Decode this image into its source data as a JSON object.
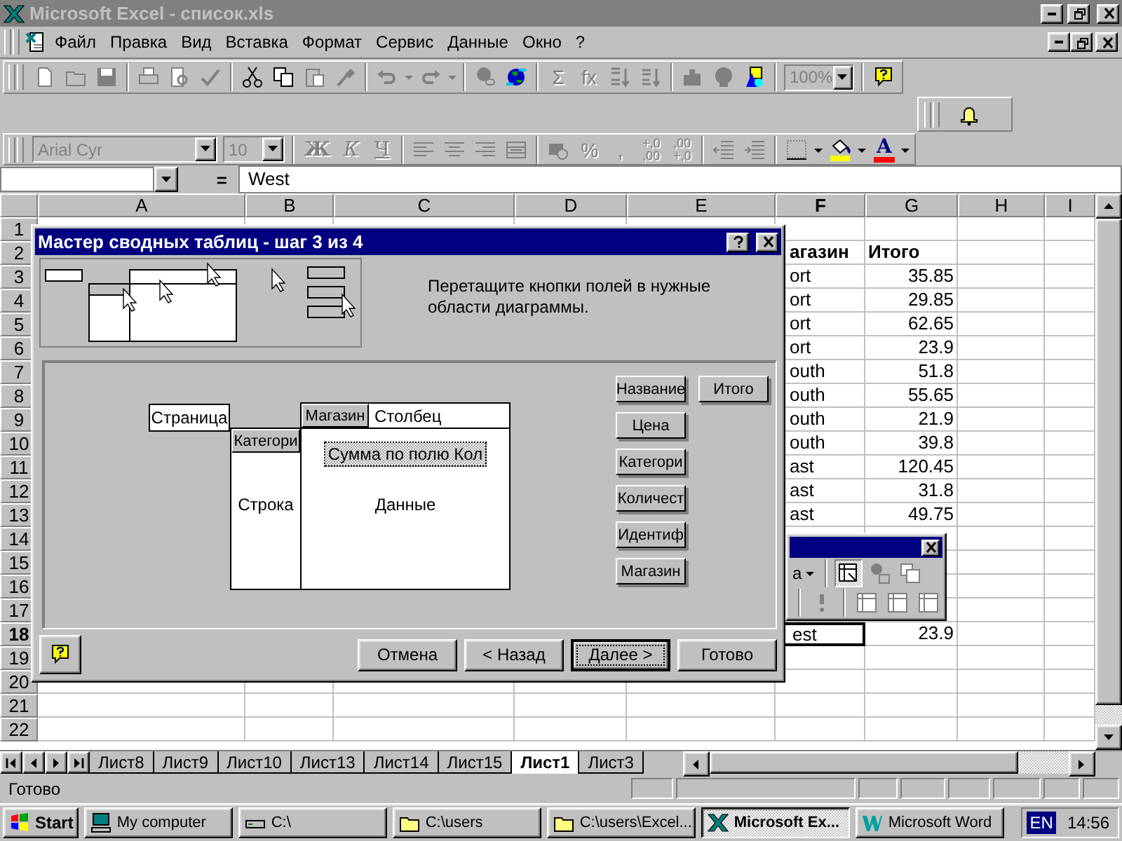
{
  "window": {
    "title": "Microsoft Excel - список.xls",
    "active": false
  },
  "menu": [
    "Файл",
    "Правка",
    "Вид",
    "Вставка",
    "Формат",
    "Сервис",
    "Данные",
    "Окно",
    "?"
  ],
  "standard_toolbar": [
    {
      "disabled": true
    },
    {
      "disabled": true
    },
    {
      "disabled": true
    },
    {
      "disabled": true
    },
    {
      "disabled": true
    },
    {
      "disabled": true
    },
    {
      "disabled": false
    },
    {
      "disabled": false
    },
    {
      "disabled": true
    },
    {
      "disabled": true
    },
    {
      "disabled": true
    },
    {
      "disabled": true
    },
    {
      "disabled": true
    },
    {
      "disabled": true
    },
    {
      "disabled": true
    },
    {
      "disabled": false
    },
    {
      "label": "Σ",
      "disabled": true
    },
    {
      "label": "fx",
      "disabled": true
    },
    {
      "disabled": true
    },
    {
      "disabled": true
    },
    {
      "disabled": true
    },
    {
      "disabled": true
    },
    {
      "disabled": false
    },
    {
      "value": "100%",
      "disabled": true
    },
    {
      "disabled": false
    }
  ],
  "formatting_toolbar": [
    {
      "value": "Arial Cyr",
      "disabled": true
    },
    {
      "value": "10",
      "disabled": true
    },
    {
      "label": "Ж",
      "disabled": true
    },
    {
      "label": "К",
      "disabled": true
    },
    {
      "label": "Ч",
      "disabled": true
    },
    {
      "disabled": true
    },
    {
      "disabled": true
    },
    {
      "disabled": true
    },
    {
      "disabled": true
    },
    {
      "disabled": true
    },
    {
      "label": "%",
      "disabled": true
    },
    {
      "label": ",",
      "disabled": true
    },
    {
      "lines": [
        "+,0",
        ",00"
      ],
      "disabled": true
    },
    {
      "lines": [
        ",00",
        "+,0"
      ],
      "disabled": true
    },
    {
      "disabled": true
    },
    {
      "disabled": true
    },
    {
      "disabled": true
    },
    {
      "disabled": false
    },
    {
      "color": "#ffff00",
      "disabled": false
    },
    {
      "disabled": false
    },
    {
      "label": "A",
      "color": "#ff0000",
      "disabled": false
    },
    {
      "disabled": false
    }
  ],
  "formula_bar": {
    "equals": "=",
    "value": "West"
  },
  "sheet": {
    "columns": [
      {
        "label": "A",
        "selected": false
      },
      {
        "label": "B",
        "selected": false
      },
      {
        "label": "C",
        "selected": false
      },
      {
        "label": "D",
        "selected": false
      },
      {
        "label": "E",
        "selected": false
      },
      {
        "label": "F",
        "selected": true
      },
      {
        "label": "G",
        "selected": false
      },
      {
        "label": "H",
        "selected": false
      },
      {
        "label": "I",
        "selected": false
      }
    ],
    "rows": [
      {
        "header": "1",
        "selected": false
      },
      {
        "header": "2",
        "selected": false,
        "kind": "heading",
        "f": "агазин",
        "g": "Итого"
      },
      {
        "header": "3",
        "selected": false,
        "f": "ort",
        "g": "35.85"
      },
      {
        "header": "4",
        "selected": false,
        "f": "ort",
        "g": "29.85"
      },
      {
        "header": "5",
        "selected": false,
        "f": "ort",
        "g": "62.65"
      },
      {
        "header": "6",
        "selected": false,
        "f": "ort",
        "g": "23.9"
      },
      {
        "header": "7",
        "selected": false,
        "f": "outh",
        "g": "51.8"
      },
      {
        "header": "8",
        "selected": false,
        "f": "outh",
        "g": "55.65"
      },
      {
        "header": "9",
        "selected": false,
        "f": "outh",
        "g": "21.9"
      },
      {
        "header": "10",
        "selected": false,
        "f": "outh",
        "g": "39.8"
      },
      {
        "header": "11",
        "selected": false,
        "f": "ast",
        "g": "120.45"
      },
      {
        "header": "12",
        "selected": false,
        "f": "ast",
        "g": "31.8"
      },
      {
        "header": "13",
        "selected": false,
        "f": "ast",
        "g": "49.75"
      },
      {
        "header": "14",
        "selected": false
      },
      {
        "header": "15",
        "selected": false
      },
      {
        "header": "16",
        "selected": false
      },
      {
        "header": "17",
        "selected": false
      },
      {
        "header": "18",
        "selected": true,
        "f": "est",
        "g": "23.9"
      },
      {
        "header": "19",
        "selected": false
      },
      {
        "header": "20",
        "selected": false
      },
      {
        "header": "21",
        "selected": false
      },
      {
        "header": "22",
        "selected": false
      }
    ]
  },
  "pivot_toolbar": {
    "dropdown_label": "а",
    "buttons": [
      {
        "pressed": true
      },
      {
        "pressed": false
      },
      {
        "pressed": false
      },
      {
        "pressed": false
      },
      {
        "pressed": false
      },
      {
        "pressed": false
      },
      {
        "pressed": false
      }
    ]
  },
  "dialog": {
    "title": "Мастер сводных таблиц - шаг 3 из 4",
    "instruction": "Перетащите кнопки полей в нужные области диаграммы.",
    "page_area": {
      "label": "Страница"
    },
    "column_area": {
      "label": "Столбец",
      "fields": [
        "Магазин"
      ]
    },
    "row_area": {
      "label": "Строка",
      "fields": [
        "Категори"
      ]
    },
    "data_area": {
      "label": "Данные",
      "fields": [
        {
          "label": "Сумма по полю Кол",
          "focused": true
        }
      ]
    },
    "available_fields": [
      "Название",
      "Цена",
      "Категори",
      "Количест",
      "Идентиф",
      "Магазин",
      "Итого"
    ],
    "buttons": [
      {
        "label": "Отмена",
        "default": false
      },
      {
        "label": "< Назад",
        "default": false
      },
      {
        "label": "Далее >",
        "default": true
      },
      {
        "label": "Готово",
        "default": false
      }
    ]
  },
  "sheet_tabs": [
    {
      "label": "Лист8",
      "selected": false
    },
    {
      "label": "Лист9",
      "selected": false
    },
    {
      "label": "Лист10",
      "selected": false
    },
    {
      "label": "Лист13",
      "selected": false
    },
    {
      "label": "Лист14",
      "selected": false
    },
    {
      "label": "Лист15",
      "selected": false
    },
    {
      "label": "Лист1",
      "selected": true
    },
    {
      "label": "Лист3",
      "selected": false
    }
  ],
  "status_bar": {
    "text": "Готово"
  },
  "taskbar": {
    "start": "Start",
    "tasks": [
      {
        "label": "My computer",
        "kind": "computer",
        "selected": false
      },
      {
        "label": "C:\\",
        "kind": "drive",
        "selected": false
      },
      {
        "label": "C:\\users",
        "kind": "folder",
        "selected": false
      },
      {
        "label": "C:\\users\\Excel...",
        "kind": "folder",
        "selected": false
      },
      {
        "label": "Microsoft Ex...",
        "kind": "excel",
        "selected": true
      },
      {
        "label": "Microsoft Word",
        "kind": "word",
        "selected": false
      }
    ],
    "language": "EN",
    "time": "14:56"
  }
}
